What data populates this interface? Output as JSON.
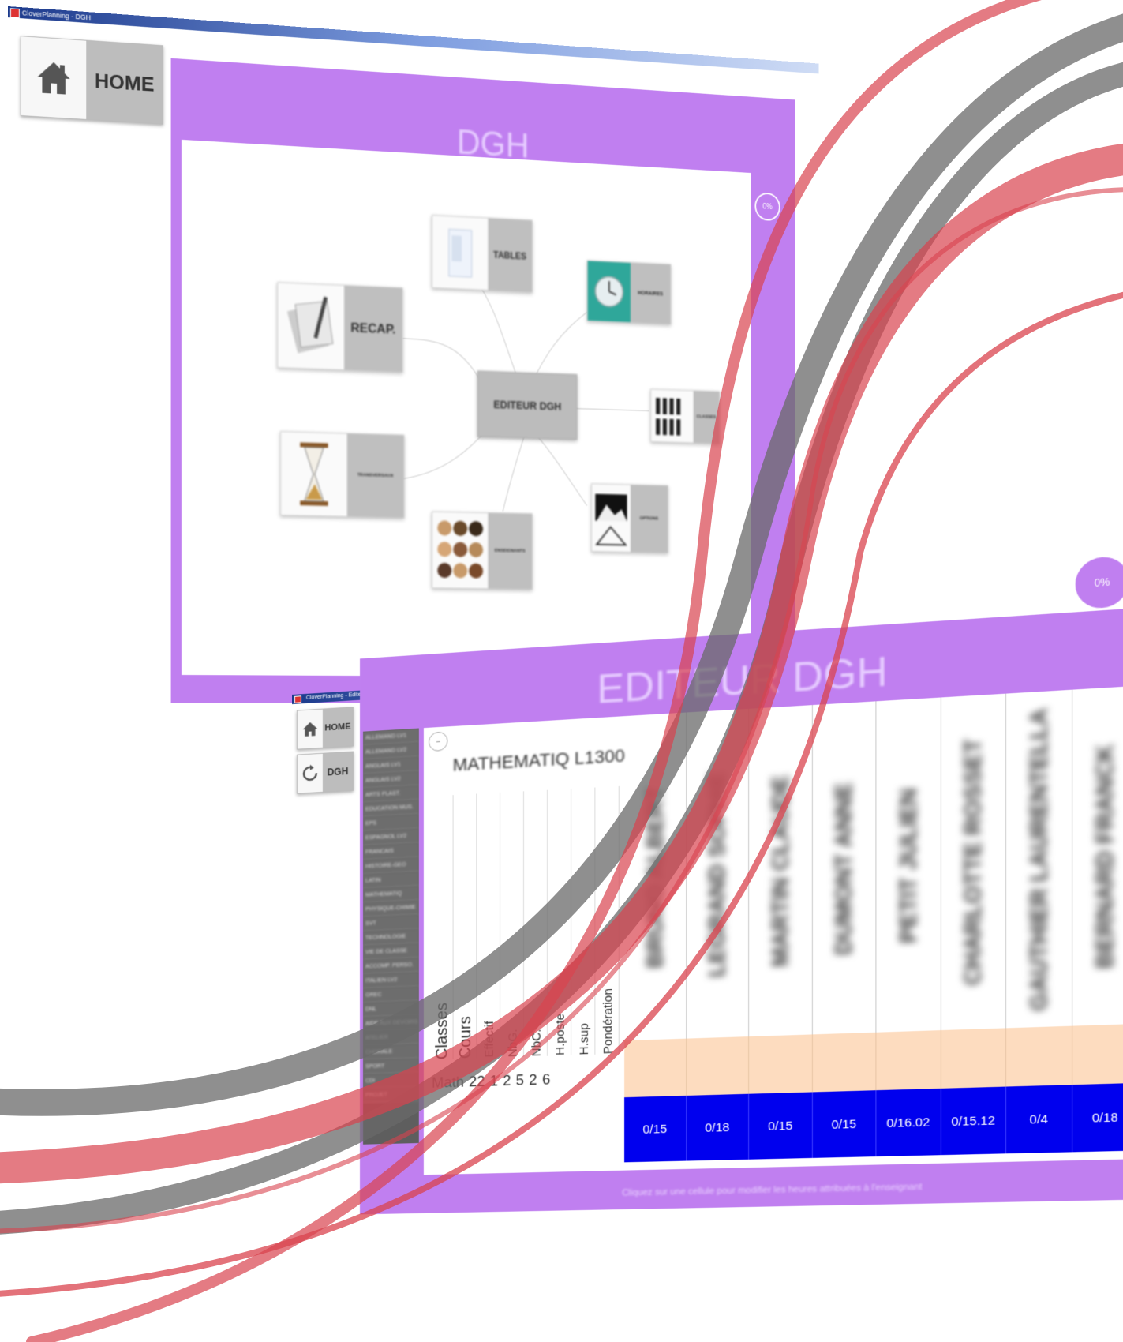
{
  "window1": {
    "title": "CloverPlanning - DGH",
    "home_label": "HOME",
    "panel_title": "DGH",
    "badge": "0%",
    "center_node": "EDITEUR DGH",
    "nodes": {
      "tables": "TABLES",
      "horaires": "HORAIRES",
      "recap": "RECAP.",
      "classes": "CLASSES",
      "transversaux": "TRANSVERSAUX",
      "enseignants": "ENSEIGNANTS",
      "options": "OPTIONS"
    }
  },
  "window2": {
    "title": "CloverPlanning - Editeur DGH",
    "home_label": "HOME",
    "dgh_label": "DGH",
    "panel_title": "EDITEUR DGH",
    "badge": "0%",
    "subject": "MATHEMATIQ L1300",
    "row_headers": [
      "Classes",
      "Cours",
      "Effectif",
      "NbG.",
      "NbC.",
      "H.poste",
      "H.sup",
      "Pondération"
    ],
    "row_values": [
      "Math",
      "22",
      "1",
      "2",
      "5",
      "2",
      "6"
    ],
    "left_list": [
      "ALLEMAND LV1",
      "ALLEMAND LV2",
      "ANGLAIS LV1",
      "ANGLAIS LV2",
      "ARTS PLAST.",
      "EDUCATION MUS.",
      "EPS",
      "ESPAGNOL LV2",
      "FRANCAIS",
      "HISTOIRE-GEO",
      "LATIN",
      "MATHEMATIQ",
      "PHYSIQUE-CHIMIE",
      "SVT",
      "TECHNOLOGIE",
      "VIE DE CLASSE",
      "ACCOMP. PERSO.",
      "ITALIEN LV2",
      "GREC",
      "DNL",
      "AIDE AUX DEVOIRS",
      "ATELIER",
      "CHORALE",
      "SPORT",
      "CDI",
      "PROJET"
    ],
    "teachers": [
      "BRUNO ALBERT",
      "LEGRAND SOPHIE",
      "MARTIN CLAUDE",
      "DUMONT ANNE",
      "PETIT JULIEN",
      "CHARLOTTE ROSSET",
      "GAUTHIER LAURENTELLA",
      "BERNARD FRANCK"
    ],
    "scores": [
      "0/15",
      "0/18",
      "0/15",
      "0/15",
      "0/16.02",
      "0/15.12",
      "0/4",
      "0/18"
    ],
    "footer": "Cliquez sur une cellule pour modifier les heures attribuées à l'enseignant"
  },
  "colors": {
    "purple": "#c07ff0",
    "score_blue": "#0000ee",
    "peach": "#fddcbf",
    "ribbon_red": "#d9434e",
    "ribbon_gray": "#6a6a6a"
  }
}
